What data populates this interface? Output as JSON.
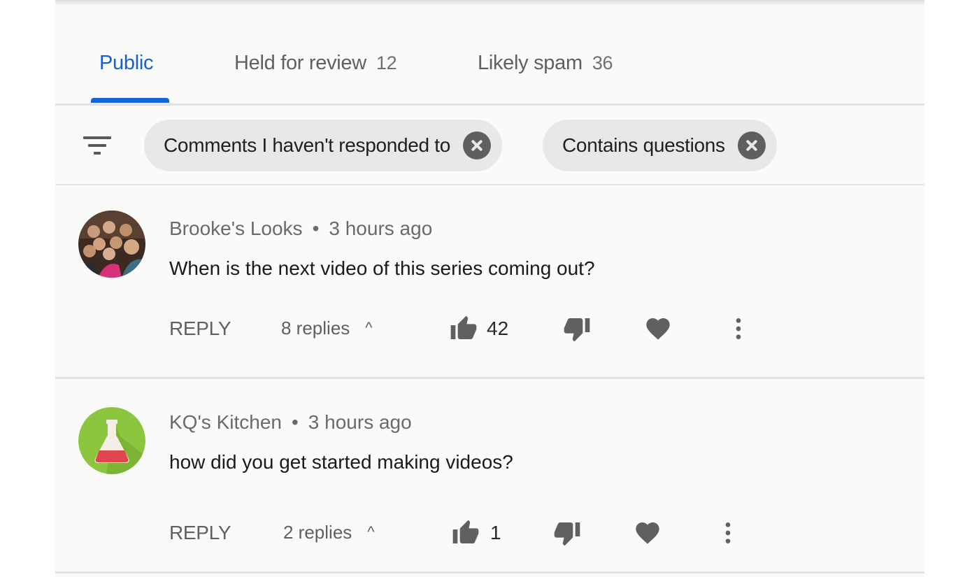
{
  "tabs": [
    {
      "label": "Public",
      "count": "",
      "active": true
    },
    {
      "label": "Held for review",
      "count": "12",
      "active": false
    },
    {
      "label": "Likely spam",
      "count": "36",
      "active": false
    }
  ],
  "filters": {
    "icon": "filter-icon",
    "chips": [
      {
        "label": "Comments I haven't responded to",
        "remove_icon": "close-circle-icon"
      },
      {
        "label": "Contains questions",
        "remove_icon": "close-circle-icon"
      }
    ]
  },
  "comments": [
    {
      "author": "Brooke's Looks",
      "separator": "•",
      "time": "3 hours ago",
      "text": "When is the next video of this series coming out?",
      "reply_label": "REPLY",
      "replies_label": "8 replies",
      "replies_caret": "^",
      "likes": "42",
      "avatar": "group-photo-avatar"
    },
    {
      "author": "KQ's Kitchen",
      "separator": "•",
      "time": "3 hours ago",
      "text": "how did you get started making videos?",
      "reply_label": "REPLY",
      "replies_label": "2 replies",
      "replies_caret": "^",
      "likes": "1",
      "avatar": "flask-avatar"
    }
  ],
  "colors": {
    "accent": "#1565d8",
    "panel_bg": "#fafaf8",
    "chip_bg": "#e8e8e8",
    "icon_gray": "#606060",
    "avatar_green": "#8cc63f",
    "flask_red": "#e0464f"
  }
}
